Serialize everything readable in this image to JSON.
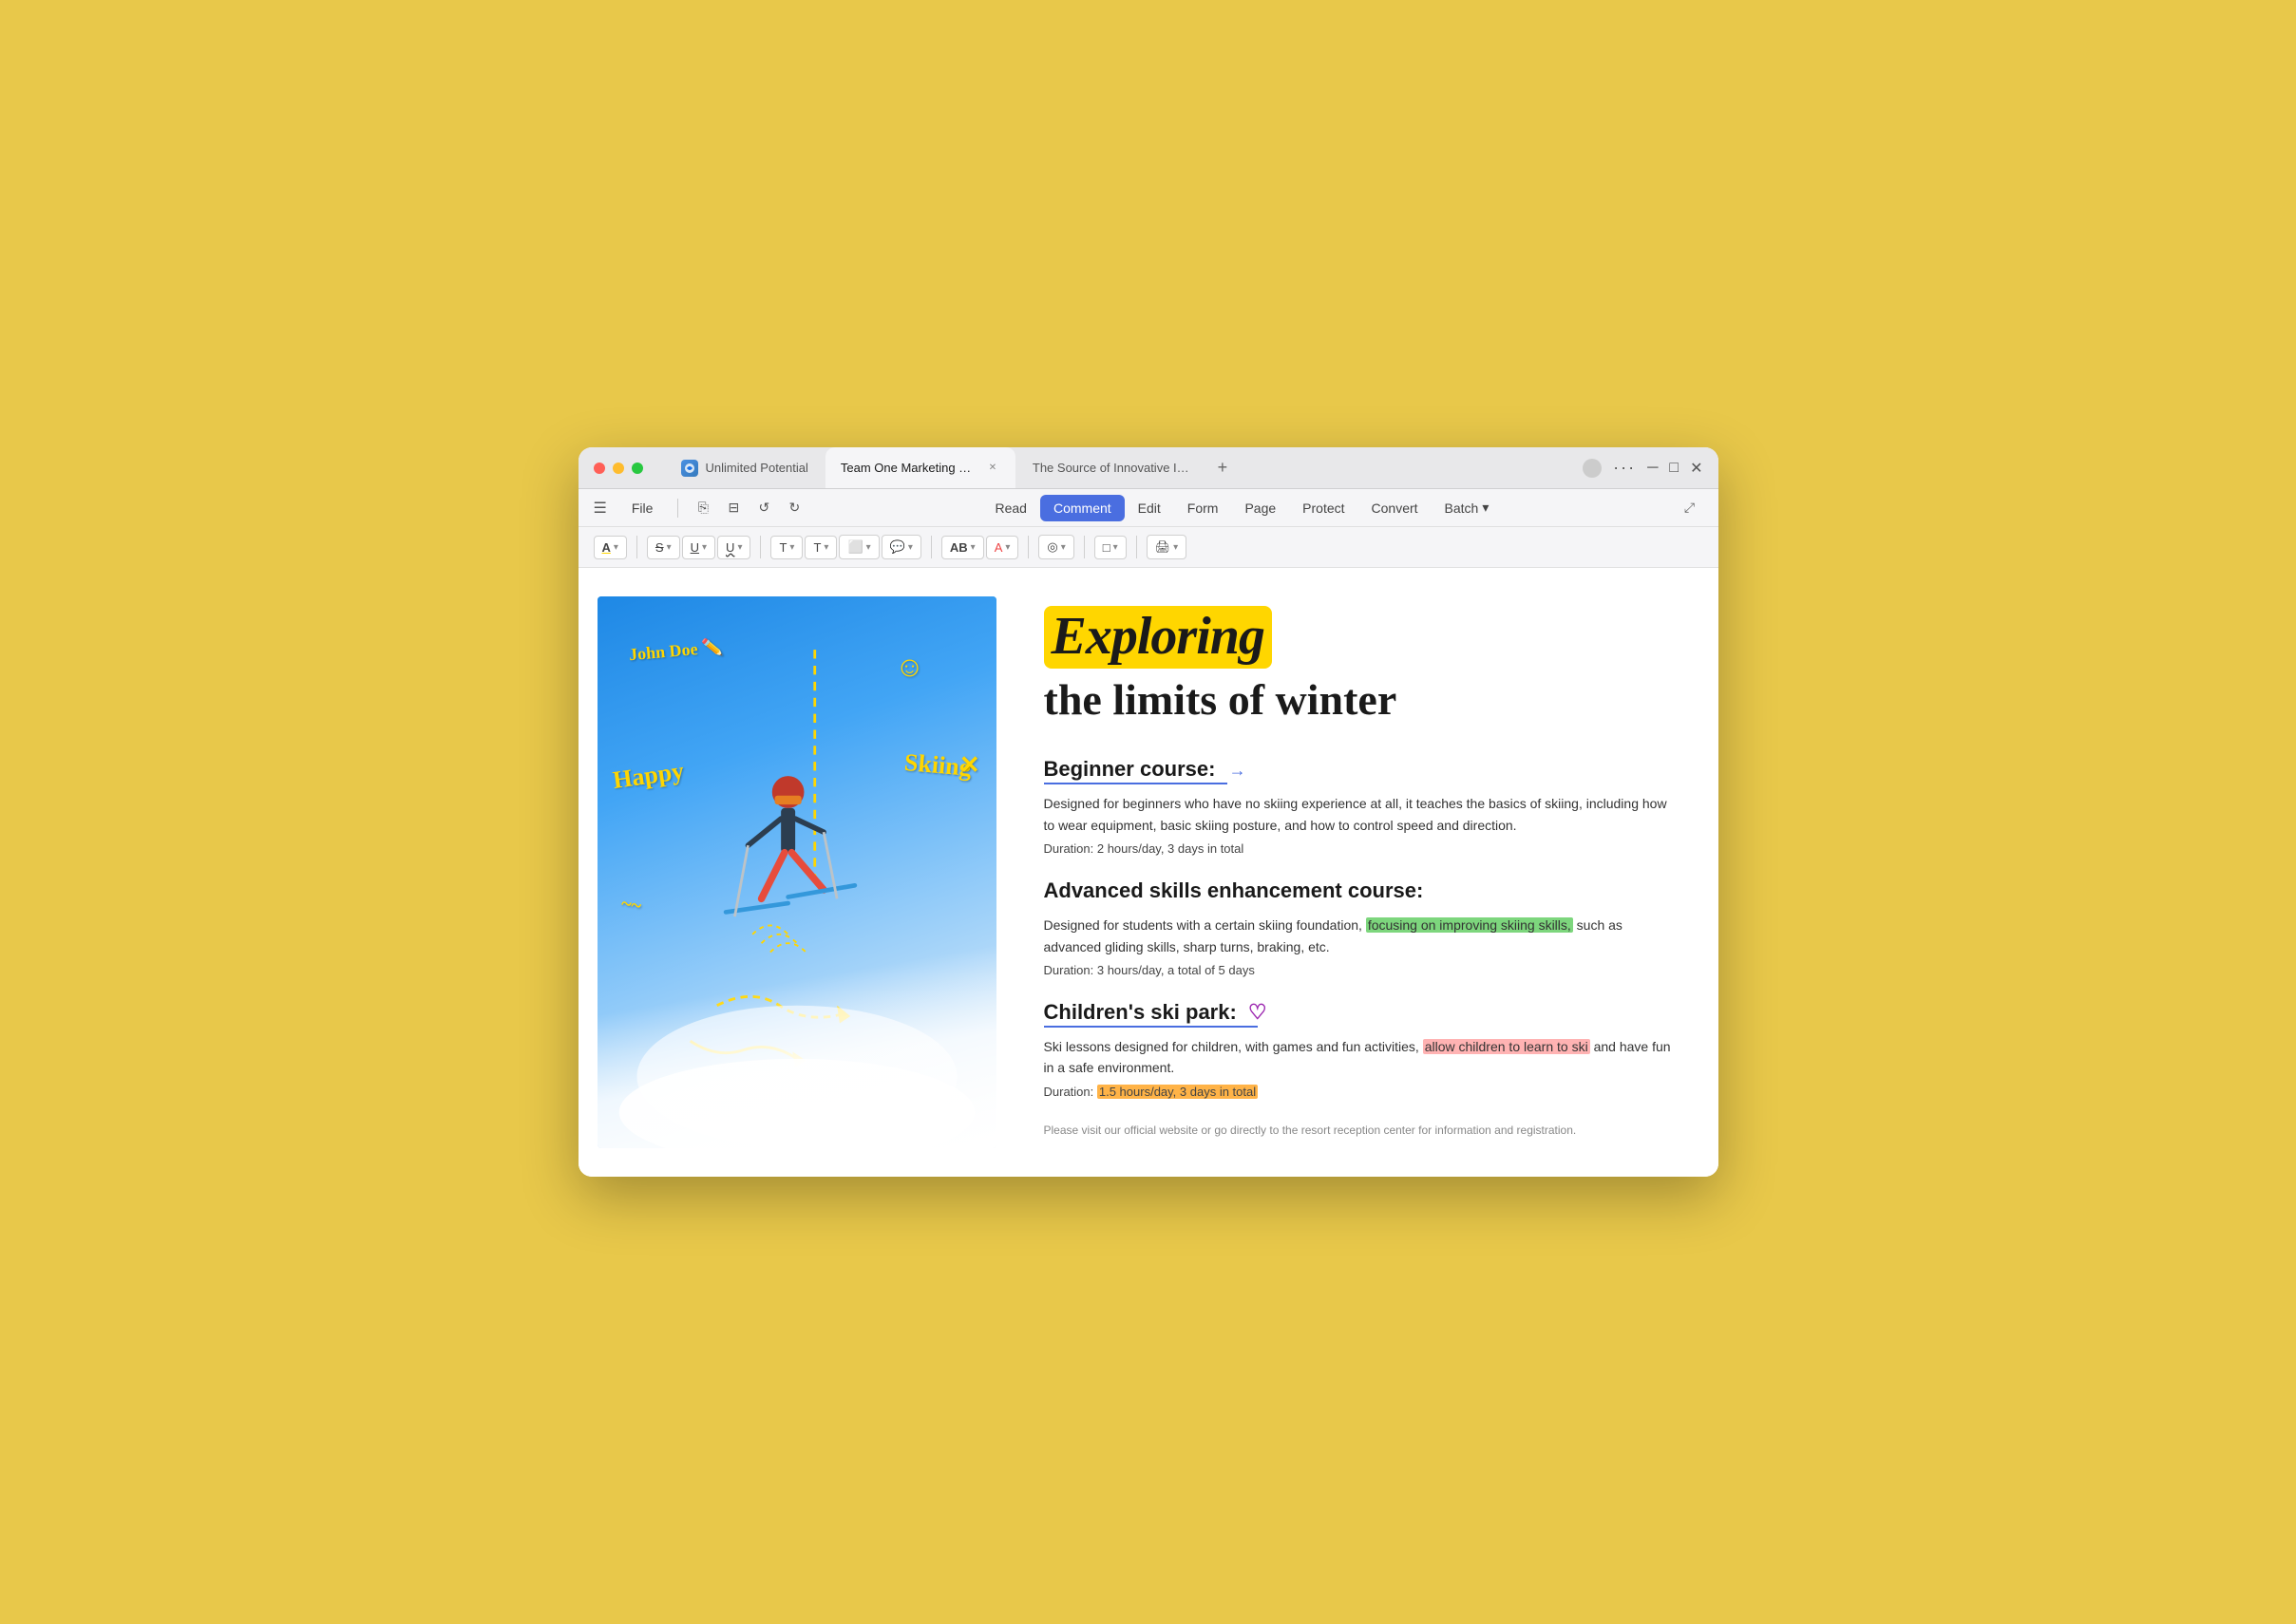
{
  "window": {
    "title": "Unlimited Potential"
  },
  "tabs": [
    {
      "id": "tab1",
      "label": "Unlimited Potential",
      "active": false,
      "hasAppIcon": true,
      "closeable": false
    },
    {
      "id": "tab2",
      "label": "Team One Marketing Str...",
      "active": true,
      "hasAppIcon": false,
      "closeable": true
    },
    {
      "id": "tab3",
      "label": "The Source of Innovative In...",
      "active": false,
      "hasAppIcon": false,
      "closeable": false
    }
  ],
  "newTabLabel": "+",
  "menuItems": {
    "file": "File",
    "read": "Read",
    "comment": "Comment",
    "edit": "Edit",
    "form": "Form",
    "page": "Page",
    "protect": "Protect",
    "convert": "Convert",
    "batch": "Batch"
  },
  "toolbar": {
    "highlightBtn": "A",
    "strikethroughBtn": "S",
    "underlineBtn": "U",
    "squigglyBtn": "U~",
    "textBtn": "T",
    "textBoxBtn": "T□",
    "calloutBtn": "□",
    "commentBtn": "💬",
    "fontSizeBtn": "AB",
    "fontColorBtn": "A",
    "eraserBtn": "◎",
    "shapeBtn": "□",
    "printBtn": "🖨"
  },
  "document": {
    "heroTitle1": "Exploring",
    "heroTitle2": "the limits of winter",
    "sections": [
      {
        "id": "beginner",
        "title": "Beginner course:",
        "body": "Designed for beginners who have no skiing experience at all, it teaches the basics of skiing, including how to wear equipment, basic skiing posture, and how to control speed and direction.",
        "duration": "Duration: 2 hours/day, 3 days in total"
      },
      {
        "id": "advanced",
        "title": "Advanced skills enhancement course:",
        "body_part1": "Designed for students with a certain skiing foundation, ",
        "body_highlighted": "focusing on improving skiing skills,",
        "body_part2": " such as advanced gliding skills, sharp turns, braking, etc.",
        "duration": "Duration: 3 hours/day, a total of 5 days"
      },
      {
        "id": "children",
        "title": "Children's ski park:",
        "body_part1": "Ski lessons designed for children, with games and fun activities, ",
        "body_highlighted_pink": "allow children to learn to ski",
        "body_part2": " and have fun in a safe environment.",
        "duration_part1": "Duration: ",
        "duration_highlighted_orange": "1.5 hours/day, 3 days in total",
        "duration_part2": ""
      }
    ],
    "footer": "Please visit our official website or go directly to the resort reception center for information and registration.",
    "imageAnnotations": {
      "johnDoe": "John Doe",
      "happy": "Happy",
      "skiing": "Skiing",
      "smiley": "☺",
      "cross": "✕"
    }
  },
  "daysInTotal": "days in total"
}
